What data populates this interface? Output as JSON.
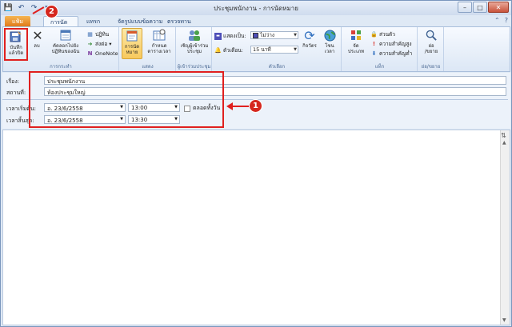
{
  "window": {
    "title": "ประชุมพนักงาน - การนัดหมาย",
    "controls": {
      "minimize": "–",
      "maximize": "□",
      "close": "✕"
    }
  },
  "qat": {
    "save": "💾",
    "undo": "↶",
    "redo": "↷",
    "customize": "▾"
  },
  "tabs": {
    "file": "แฟ้ม",
    "appointment": "การนัดหมาย",
    "insert": "แทรก",
    "format": "จัดรูปแบบข้อความ",
    "review": "ตรวจทาน"
  },
  "ribbon": {
    "actions": {
      "save_close": [
        "บันทึก",
        "แล้วปิด"
      ],
      "delete": "ลบ",
      "copy_calendar": [
        "คัดลอกไปยัง",
        "ปฏิทินของฉัน"
      ],
      "calendar": "ปฏิทิน",
      "forward": "ส่งต่อ",
      "onenote": "OneNote",
      "label": "การกระทำ"
    },
    "show": {
      "appointment": [
        "การนัด",
        "หมาย"
      ],
      "scheduling": [
        "กำหนด",
        "ตารางเวลา"
      ],
      "label": "แสดง"
    },
    "attendees": {
      "invite": [
        "เชิญผู้เข้าร่วม",
        "ประชุม"
      ],
      "label": "ผู้เข้าร่วมประชุม"
    },
    "options": {
      "show_as_label": "แสดงเป็น:",
      "show_as_value": "ไม่ว่าง",
      "reminder_label": "ตัวเตือน:",
      "reminder_value": "15 นาที",
      "recurrence": "กิจวัตร",
      "time_zones": [
        "โซน",
        "เวลา"
      ],
      "label": "ตัวเลือก"
    },
    "tags": {
      "categorize": [
        "จัด",
        "ประเภท"
      ],
      "private": "ส่วนตัว",
      "high_importance": "ความสำคัญสูง",
      "low_importance": "ความสำคัญต่ำ",
      "label": "แท็ก"
    },
    "zoom": {
      "zoom": [
        "ย่อ",
        "/ขยาย"
      ],
      "label": "ย่อ/ขยาย"
    }
  },
  "form": {
    "subject_label": "เรื่อง:",
    "subject_value": "ประชุมพนักงาน",
    "location_label": "สถานที่:",
    "location_value": "ห้องประชุมใหญ่",
    "start_label": "เวลาเริ่มต้น:",
    "start_date": "อ. 23/6/2558",
    "start_time": "13:00",
    "end_label": "เวลาสิ้นสุด:",
    "end_date": "อ. 23/6/2558",
    "end_time": "13:30",
    "all_day_label": "ตลอดทั้งวัน"
  },
  "annotations": {
    "badge1": "1",
    "badge2": "2"
  },
  "colors": {
    "highlight": "#e0201f",
    "file_tab": "#e07b1b",
    "show_as_swatch": "#4e4fb8"
  }
}
